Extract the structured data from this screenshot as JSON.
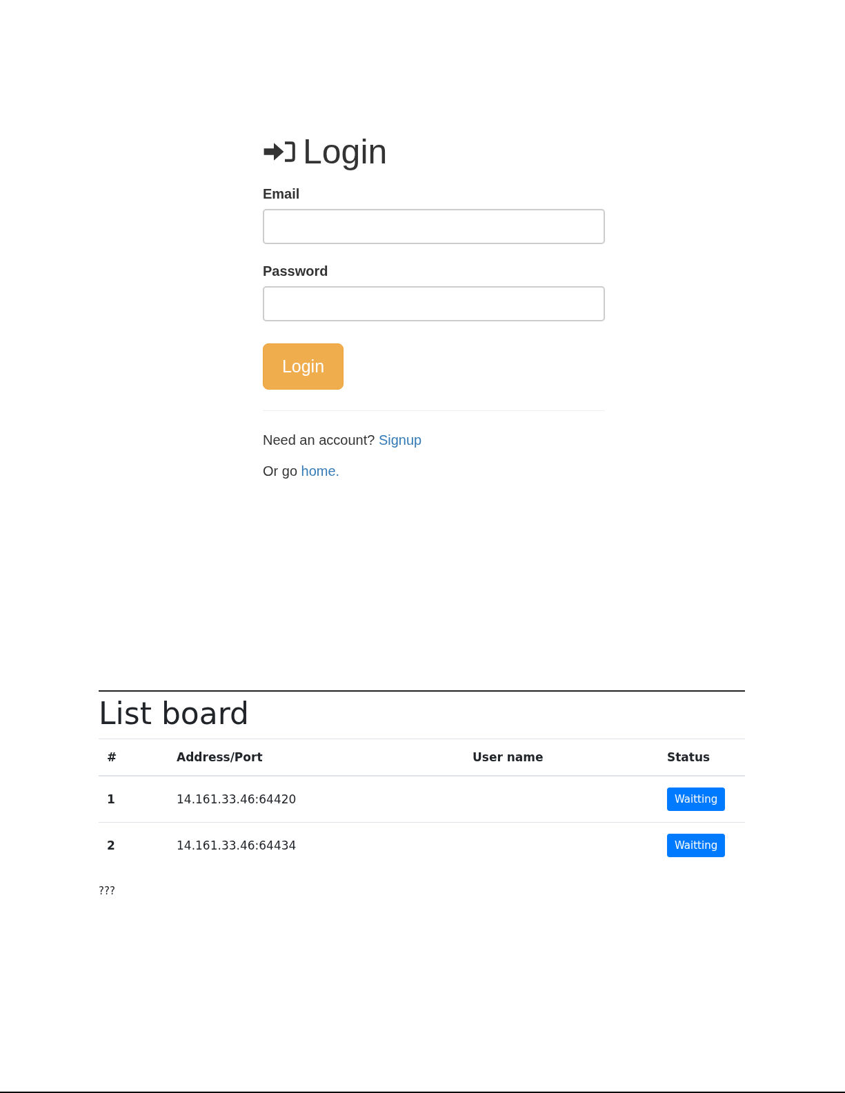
{
  "login": {
    "title": "Login",
    "fields": [
      {
        "label": "Email"
      },
      {
        "label": "Password"
      }
    ],
    "button": "Login",
    "signup_prompt": {
      "text": "Need an account?",
      "link": "Signup"
    },
    "home_prompt": {
      "text": "Or go",
      "link": "home."
    }
  },
  "list_board": {
    "title": "List board",
    "columns": [
      "#",
      "Address/Port",
      "User name",
      "Status"
    ],
    "rows": [
      {
        "index": "1",
        "address": "14.161.33.46:64420",
        "status": "Waitting"
      },
      {
        "index": "2",
        "address": "14.161.33.46:64434",
        "status": "Waitting"
      }
    ],
    "footer_text": "???"
  }
}
